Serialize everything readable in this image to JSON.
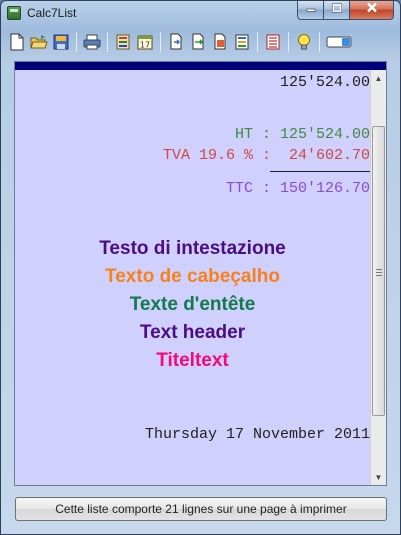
{
  "window": {
    "title": "Calc7List"
  },
  "report": {
    "subtotal": "125'524.00",
    "ht_label": "HT :",
    "ht_value": "125'524.00",
    "tva_label": "TVA 19.6 % :",
    "tva_value": "24'602.70",
    "ttc_label": "TTC :",
    "ttc_value": "150'126.70",
    "headers": [
      {
        "text": "Testo di intestazione",
        "color": "#4b0d82"
      },
      {
        "text": "Texto de cabeçalho",
        "color": "#f7811b"
      },
      {
        "text": "Texte d'entête",
        "color": "#127a4d"
      },
      {
        "text": "Text header",
        "color": "#4b0d82"
      },
      {
        "text": "Titeltext",
        "color": "#f20a79"
      }
    ],
    "date": "Thursday 17 November 2011"
  },
  "colors": {
    "ht": "#3f8b3f",
    "tva": "#d24646",
    "ttc": "#8a4bd6",
    "default": "#1f1f1f",
    "doc_bg": "#d0d0fc",
    "doc_bar": "#00007a"
  },
  "status": {
    "label": "Cette liste comporte 21 lignes sur une page à imprimer"
  },
  "toolbar": {
    "icons": [
      "new-doc-icon",
      "open-folder-icon",
      "save-icon",
      "print-icon",
      "calculator-icon",
      "calendar-icon",
      "copy-icon",
      "export-icon",
      "edit-icon",
      "color-list-icon",
      "list-icon",
      "lightbulb-icon",
      "toggle-icon"
    ]
  }
}
